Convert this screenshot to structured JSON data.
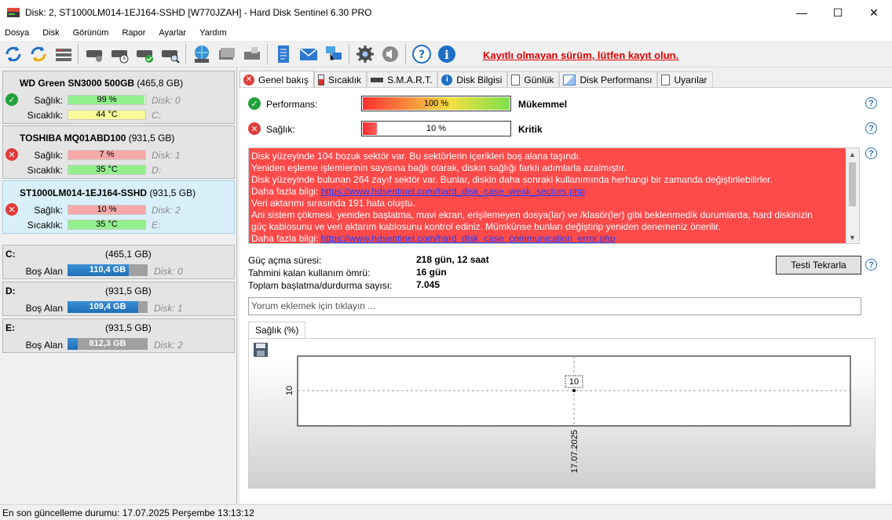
{
  "window": {
    "title": "Disk: 2, ST1000LM014-1EJ164-SSHD [W770JZAH]  -  Hard Disk Sentinel 6.30 PRO",
    "minimize": "—",
    "maximize": "☐",
    "close": "✕"
  },
  "menu": [
    "Dosya",
    "Disk",
    "Görünüm",
    "Rapor",
    "Ayarlar",
    "Yardım"
  ],
  "toolbar": {
    "unregistered_text": "Kayıtlı olmayan sürüm, lütfen kayıt olun."
  },
  "disks": [
    {
      "name": "WD Green SN3000 500GB",
      "size": "(465,8 GB)",
      "health_label": "Sağlık:",
      "health": "99 %",
      "health_pct": 99,
      "disk_label": "Disk: 0",
      "temp_label": "Sıcaklık:",
      "temp": "44 °C",
      "drive": "C:",
      "status": "ok"
    },
    {
      "name": "TOSHIBA MQ01ABD100",
      "size": "(931,5 GB)",
      "health_label": "Sağlık:",
      "health": "7 %",
      "health_pct": 7,
      "disk_label": "Disk: 1",
      "temp_label": "Sıcaklık:",
      "temp": "35 °C",
      "drive": "D:",
      "status": "bad"
    },
    {
      "name": "ST1000LM014-1EJ164-SSHD",
      "size": "(931,5 GB)",
      "health_label": "Sağlık:",
      "health": "10 %",
      "health_pct": 10,
      "disk_label": "Disk: 2",
      "temp_label": "Sıcaklık:",
      "temp": "35 °C",
      "drive": "E:",
      "status": "bad"
    }
  ],
  "drives": [
    {
      "letter": "C:",
      "size": "(465,1 GB)",
      "free_label": "Boş Alan",
      "free": "110,4 GB",
      "free_pct": 24,
      "disk_label": "Disk: 0"
    },
    {
      "letter": "D:",
      "size": "(931,5 GB)",
      "free_label": "Boş Alan",
      "free": "109,4 GB",
      "free_pct": 12,
      "disk_label": "Disk: 1"
    },
    {
      "letter": "E:",
      "size": "(931,5 GB)",
      "free_label": "Boş Alan",
      "free": "812,3 GB",
      "free_pct": 13,
      "disk_label": "Disk: 2"
    }
  ],
  "tabs": [
    "Genel bakış",
    "Sıcaklık",
    "S.M.A.R.T.",
    "Disk Bilgisi",
    "Günlük",
    "Disk Performansı",
    "Uyarılar"
  ],
  "overview": {
    "performance_label": "Performans:",
    "performance_value": "100 %",
    "performance_pct": 100,
    "performance_rating": "Mükemmel",
    "health_label": "Sağlık:",
    "health_value": "10 %",
    "health_pct": 10,
    "health_rating": "Kritik",
    "messages": [
      "Disk yüzeyinde 104 bozuk sektör var. Bu sektörlerin içerikleri boş alana taşındı.",
      "Yeniden eşleme işlemlerinin sayısına bağlı olarak, diskin sağlığı farklı adımlarla azalmıştır.",
      "Disk yüzeyinde bulunan 264 zayıf sektör var. Bunlar, diskin daha sonraki kullanımında herhangi bir zamanda değiştirilebilirler."
    ],
    "more_info_label": "Daha fazla bilgi:",
    "link1": "https://www.hdsentinel.com/hard_disk_case_weak_sectors.php",
    "messages2": [
      "Veri aktarımı sırasında 191 hata oluştu.",
      "Ani sistem çökmesi, yeniden başlatma, mavi ekran, erişilemeyen dosya(lar) ve /klasör(ler) gibi beklenmedik durumlarda, hard diskinizin",
      "güç kablosunu ve veri aktarım kablosunu kontrol ediniz. Mümkünse bunları değiştirip yeniden denemeniz önerilir."
    ],
    "link2": "https://www.hdsentinel.com/hard_disk_case_communication_error.php",
    "power_on_label": "Güç açma süresi:",
    "power_on": "218 gün, 12 saat",
    "remaining_label": "Tahmini kalan kullanım ömrü:",
    "remaining": "16 gün",
    "startstop_label": "Toplam başlatma/durdurma sayısı:",
    "startstop": "7.045",
    "retest_button": "Testi Tekrarla",
    "comment_placeholder": "Yorum eklemek için tıklayın ...",
    "chart_tab": "Sağlık (%)"
  },
  "chart_data": {
    "type": "line",
    "title": "",
    "x": [
      "17.07.2025"
    ],
    "series": [
      {
        "values": [
          10
        ]
      }
    ],
    "y_ticks": [
      "10"
    ],
    "point_label": "10",
    "xlabel": "",
    "ylabel": ""
  },
  "statusbar": {
    "text": "En son güncelleme durumu: 17.07.2025 Perşembe 13:13:12"
  }
}
